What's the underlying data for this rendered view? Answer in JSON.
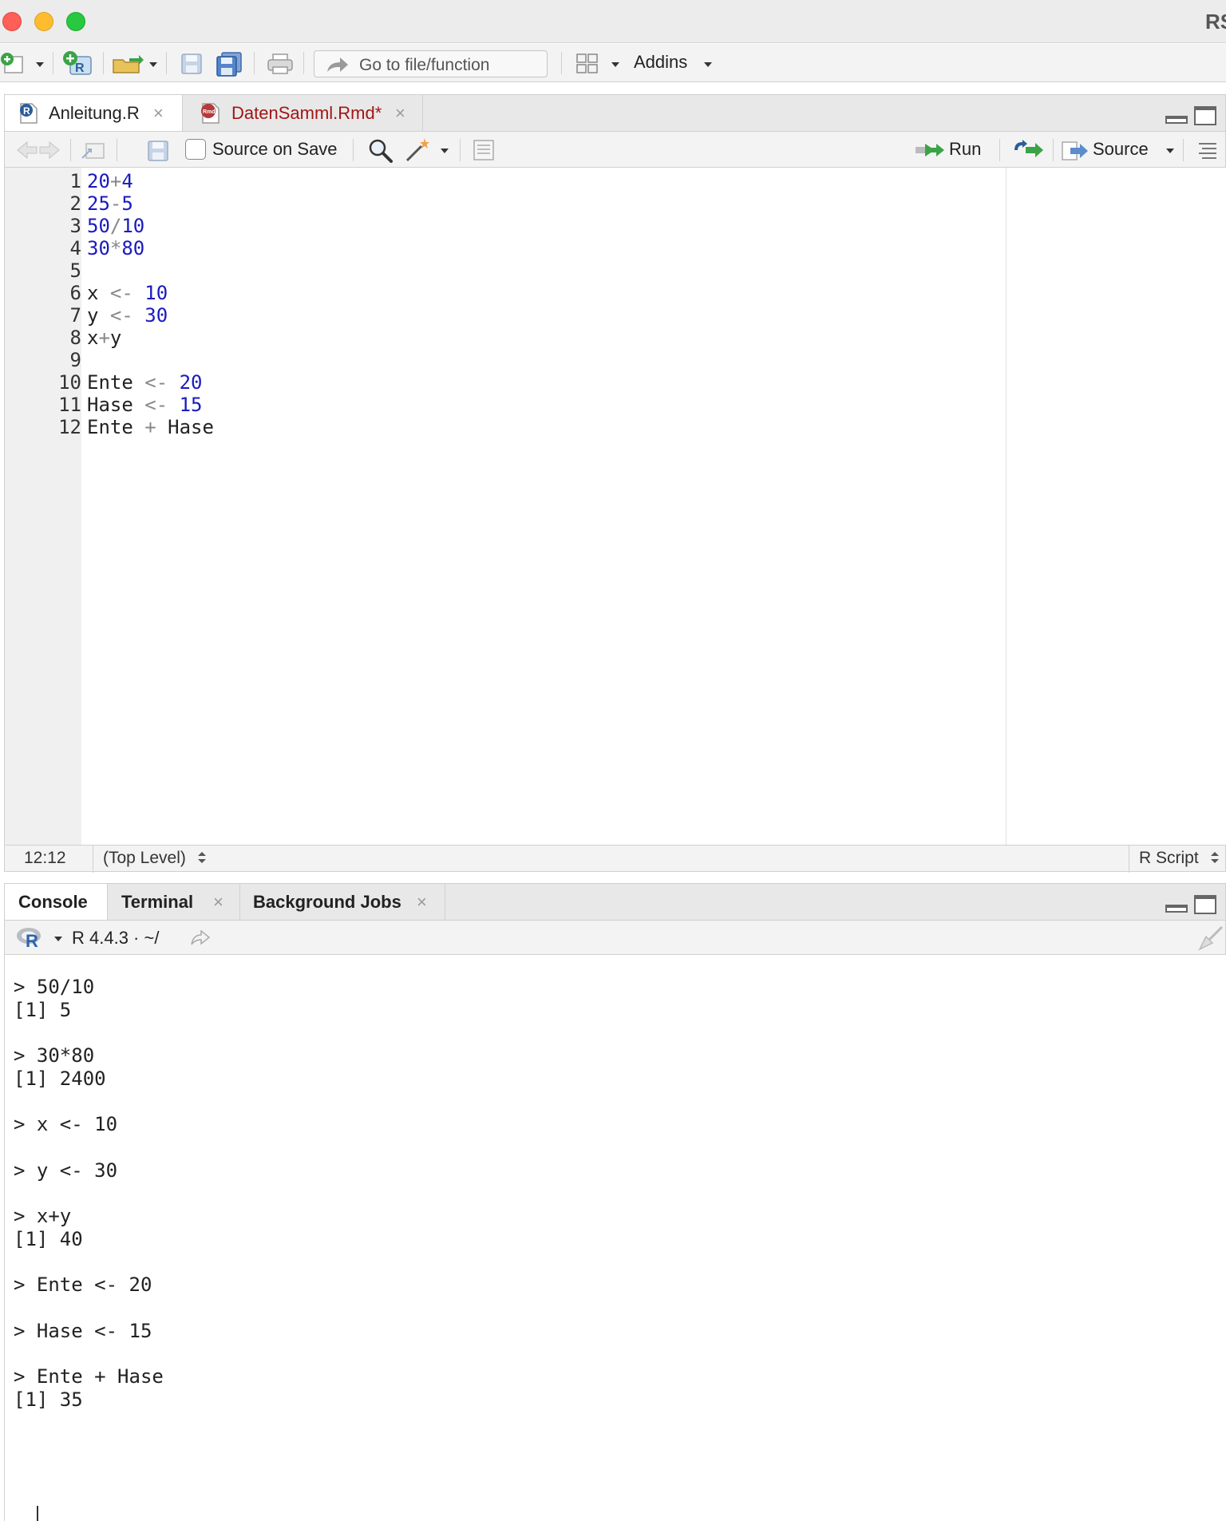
{
  "window": {
    "title": "RStudio"
  },
  "toolbar": {
    "goto_placeholder": "Go to file/function",
    "addins_label": "Addins",
    "icons": [
      "new-file-icon",
      "new-project-icon",
      "open-folder-icon",
      "save-icon",
      "save-all-icon",
      "print-icon",
      "workspace-panes-icon"
    ]
  },
  "editor": {
    "tabs": [
      {
        "label": "Anleitung.R",
        "active": true,
        "color": "#222222"
      },
      {
        "label": "DatenSamml.Rmd*",
        "active": false,
        "color": "#a31515"
      }
    ],
    "toolbar": {
      "source_on_save": "Source on Save",
      "run_label": "Run",
      "source_label": "Source"
    },
    "lines": [
      {
        "n": "1",
        "tokens": [
          {
            "t": "20",
            "c": "num"
          },
          {
            "t": "+",
            "c": "op"
          },
          {
            "t": "4",
            "c": "num"
          }
        ]
      },
      {
        "n": "2",
        "tokens": [
          {
            "t": "25",
            "c": "num"
          },
          {
            "t": "-",
            "c": "op"
          },
          {
            "t": "5",
            "c": "num"
          }
        ]
      },
      {
        "n": "3",
        "tokens": [
          {
            "t": "50",
            "c": "num"
          },
          {
            "t": "/",
            "c": "op"
          },
          {
            "t": "10",
            "c": "num"
          }
        ]
      },
      {
        "n": "4",
        "tokens": [
          {
            "t": "30",
            "c": "num"
          },
          {
            "t": "*",
            "c": "op"
          },
          {
            "t": "80",
            "c": "num"
          }
        ]
      },
      {
        "n": "5",
        "tokens": []
      },
      {
        "n": "6",
        "tokens": [
          {
            "t": "x ",
            "c": "txt"
          },
          {
            "t": "<-",
            "c": "op"
          },
          {
            "t": " ",
            "c": "txt"
          },
          {
            "t": "10",
            "c": "num"
          }
        ]
      },
      {
        "n": "7",
        "tokens": [
          {
            "t": "y ",
            "c": "txt"
          },
          {
            "t": "<-",
            "c": "op"
          },
          {
            "t": " ",
            "c": "txt"
          },
          {
            "t": "30",
            "c": "num"
          }
        ]
      },
      {
        "n": "8",
        "tokens": [
          {
            "t": "x",
            "c": "txt"
          },
          {
            "t": "+",
            "c": "op"
          },
          {
            "t": "y",
            "c": "txt"
          }
        ]
      },
      {
        "n": "9",
        "tokens": []
      },
      {
        "n": "10",
        "tokens": [
          {
            "t": "Ente ",
            "c": "txt"
          },
          {
            "t": "<-",
            "c": "op"
          },
          {
            "t": " ",
            "c": "txt"
          },
          {
            "t": "20",
            "c": "num"
          }
        ]
      },
      {
        "n": "11",
        "tokens": [
          {
            "t": "Hase ",
            "c": "txt"
          },
          {
            "t": "<-",
            "c": "op"
          },
          {
            "t": " ",
            "c": "txt"
          },
          {
            "t": "15",
            "c": "num"
          }
        ]
      },
      {
        "n": "12",
        "tokens": [
          {
            "t": "Ente ",
            "c": "txt"
          },
          {
            "t": "+",
            "c": "op"
          },
          {
            "t": " Hase",
            "c": "txt"
          }
        ]
      }
    ],
    "status": {
      "cursor": "12:12",
      "scope": "(Top Level)",
      "filetype": "R Script"
    }
  },
  "console": {
    "tabs": [
      {
        "label": "Console",
        "closable": false
      },
      {
        "label": "Terminal",
        "closable": true
      },
      {
        "label": "Background Jobs",
        "closable": true
      }
    ],
    "r_version": "R 4.4.3 · ~/",
    "lines": [
      "> 50/10",
      "[1] 5",
      "",
      "> 30*80",
      "[1] 2400",
      "",
      "> x <- 10",
      "",
      "> y <- 30",
      "",
      "> x+y",
      "[1] 40",
      "",
      "> Ente <- 20",
      "",
      "> Hase <- 15",
      "",
      "> Ente + Hase",
      "[1] 35"
    ]
  },
  "colors": {
    "number": "#1a1abf",
    "operator": "#888888",
    "rmd_tab": "#a31515"
  }
}
